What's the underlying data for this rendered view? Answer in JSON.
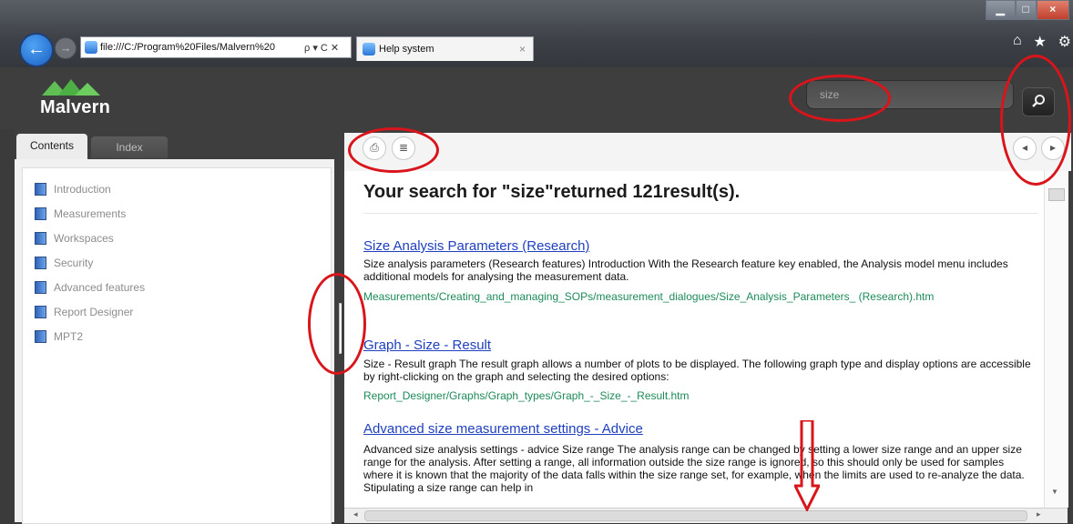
{
  "browser": {
    "address": "file:///C:/Program%20Files/Malvern%20",
    "address_actions": "ρ ▾ C ✕",
    "tab_title": "Help system",
    "tab_close": "×",
    "back_glyph": "←",
    "forward_glyph": "→",
    "window_min": "▁",
    "window_max": "□",
    "window_close": "×",
    "toolbar_icons": [
      "⌂",
      "★",
      "⚙"
    ]
  },
  "header": {
    "logo_text": "Malvern",
    "search": {
      "value": "size"
    },
    "search_button_icon": "search-icon"
  },
  "sidebar": {
    "tabs": [
      {
        "label": "Contents"
      },
      {
        "label": "Index"
      }
    ],
    "items": [
      {
        "label": "Introduction"
      },
      {
        "label": "Measurements"
      },
      {
        "label": "Workspaces"
      },
      {
        "label": "Security"
      },
      {
        "label": "Advanced features"
      },
      {
        "label": "Report Designer"
      },
      {
        "label": "MPT2"
      }
    ]
  },
  "toolbar": {
    "print_glyph": "⎙",
    "toc_glyph": "≣",
    "prev_glyph": "◂",
    "next_glyph": "▸"
  },
  "results": {
    "heading": "Your search for \"size\"returned 121result(s).",
    "items": [
      {
        "title": "Size Analysis Parameters (Research)",
        "description": "Size analysis parameters (Research features) Introduction With the Research feature key enabled, the Analysis model menu includes additional models for analysing the measurement data.",
        "path": "Measurements/Creating_and_managing_SOPs/measurement_dialogues/Size_Analysis_Parameters_ (Research).htm"
      },
      {
        "title": "Graph - Size - Result",
        "description": "Size - Result graph The result graph allows a number of plots to be displayed. The following graph type and display options are accessible by right-clicking on the graph and selecting the desired options:",
        "path": "Report_Designer/Graphs/Graph_types/Graph_-_Size_-_Result.htm"
      },
      {
        "title": "Advanced size measurement settings - Advice",
        "description": "Advanced size analysis settings - advice Size range The analysis range can be changed by setting a lower size range and an upper size range for the analysis. After setting a range, all information outside the size range is ignored, so this should only be used for samples where it is known that the majority of the data falls within the size range set, for example, when the limits are used to re-analyze the data. Stipulating a size range can help in",
        "path": ""
      }
    ]
  },
  "colors": {
    "annotation_red": "#d9141a",
    "link_blue": "#1f3fbf",
    "path_green": "#1d8a5a",
    "logo_green": "#5fbf55"
  }
}
